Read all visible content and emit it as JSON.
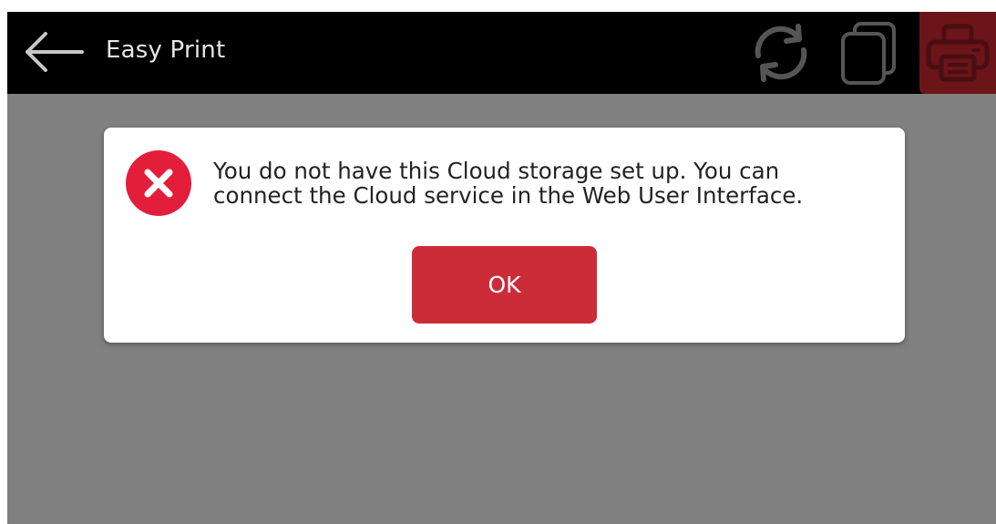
{
  "header": {
    "title": "Easy Print",
    "back_icon": "arrow-left-icon",
    "actions": [
      {
        "name": "refresh",
        "icon": "refresh-icon"
      },
      {
        "name": "copy",
        "icon": "copy-icon"
      },
      {
        "name": "print",
        "icon": "printer-icon"
      }
    ]
  },
  "dialog": {
    "icon": "error-x-icon",
    "message_line1": "You do not have this Cloud storage set up. You can",
    "message_line2": "connect the Cloud service in the Web User Interface.",
    "ok_label": "OK"
  },
  "colors": {
    "topbar": "#000000",
    "overlay": "#808080",
    "accent": "#cc2c38",
    "print_button_bg": "#6b1519",
    "error_icon": "#e31e3a"
  }
}
